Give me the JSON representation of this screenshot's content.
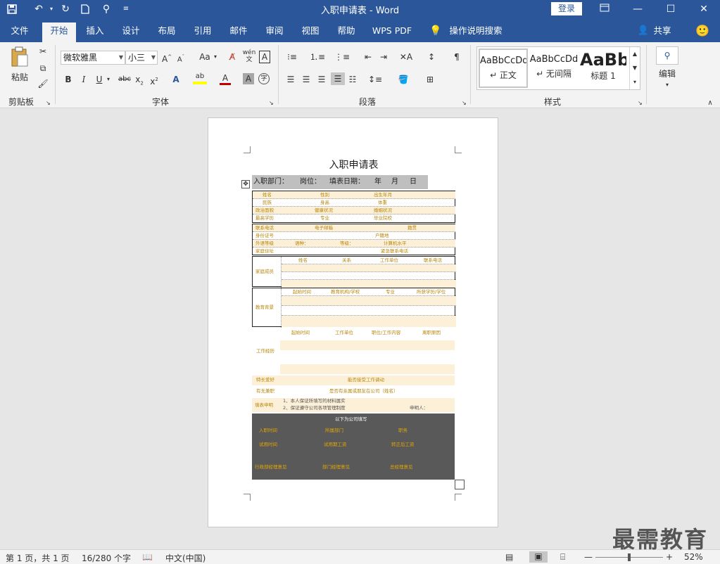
{
  "title_bar": {
    "document_title": "入职申请表 - Word",
    "login_label": "登录",
    "quick_access_icons": [
      "save-icon",
      "undo-icon",
      "redo-icon",
      "new-document-icon",
      "touch-mode-icon",
      "customize-dropdown-icon"
    ]
  },
  "tabs": [
    {
      "label": "文件"
    },
    {
      "label": "开始"
    },
    {
      "label": "插入"
    },
    {
      "label": "设计"
    },
    {
      "label": "布局"
    },
    {
      "label": "引用"
    },
    {
      "label": "邮件"
    },
    {
      "label": "审阅"
    },
    {
      "label": "视图"
    },
    {
      "label": "帮助"
    },
    {
      "label": "WPS PDF"
    },
    {
      "label": "操作说明搜索"
    }
  ],
  "share_label": "共享",
  "ribbon": {
    "clipboard": {
      "paste_label": "粘贴",
      "group_label": "剪贴板"
    },
    "font": {
      "font_name": "微软雅黑",
      "font_size": "小三",
      "aa_label": "Aa",
      "wen_label": "wén",
      "group_label": "字体"
    },
    "paragraph": {
      "group_label": "段落"
    },
    "styles": {
      "items": [
        {
          "sample": "AaBbCcDd",
          "name": "↵ 正文"
        },
        {
          "sample": "AaBbCcDd",
          "name": "↵ 无间隔"
        },
        {
          "sample": "AaBb",
          "name": "标题 1"
        }
      ],
      "group_label": "样式"
    },
    "editing": {
      "label": "编辑"
    }
  },
  "document": {
    "title": "入职申请表",
    "header_band": {
      "department": "入职部门：",
      "position": "岗位：",
      "fill_date": "填表日期：",
      "year": "年",
      "month": "月",
      "day": "日"
    },
    "basic_rows": [
      [
        "姓名",
        "性别",
        "出生年月"
      ],
      [
        "民族",
        "身高",
        "体重"
      ],
      [
        "政治面貌",
        "健康状况",
        "婚姻状况"
      ],
      [
        "最高学历",
        "专业",
        "毕业院校"
      ]
    ],
    "contact_rows": [
      [
        "联系电话",
        "电子邮箱",
        "籍贯"
      ],
      [
        "身份证号",
        "户籍地"
      ],
      [
        "外语等级",
        "语种：",
        "等级：",
        "计算机水平"
      ],
      [
        "家庭住址",
        "紧急联系电话"
      ]
    ],
    "family": {
      "label": "家庭成员",
      "headers": [
        "姓名",
        "关系",
        "工作单位",
        "联系电话"
      ]
    },
    "education": {
      "label": "教育背景",
      "headers": [
        "起始时间",
        "教育机构/学校",
        "专业",
        "所获学历/学位"
      ]
    },
    "work": {
      "label": "工作经历",
      "headers": [
        "起始时间",
        "工作单位",
        "职位/工作内容",
        "离职原因"
      ]
    },
    "extra_rows": [
      [
        "特长爱好",
        "能否接受工作调动"
      ],
      [
        "有无兼职",
        "是否有亲属或朋友在公司（姓名）"
      ]
    ],
    "declaration": {
      "label": "填表申明",
      "line1": "1、本人保证所填写的材料属实",
      "line2": "2、保证遵守公司各项管理制度",
      "signature": "申明人："
    },
    "company_section": {
      "title": "以下为公司填写",
      "rows": [
        [
          "入职时间",
          "所属部门",
          "职务"
        ],
        [
          "试用时间",
          "试用期工资",
          "转正后工资"
        ],
        [
          "行政部经理意见",
          "部门经理意见",
          "总经理意见"
        ]
      ]
    }
  },
  "status_bar": {
    "page_info": "第 1 页，共 1 页",
    "word_count": "16/280 个字",
    "language": "中文(中国)",
    "zoom": "52%"
  },
  "watermark": "最需教育"
}
